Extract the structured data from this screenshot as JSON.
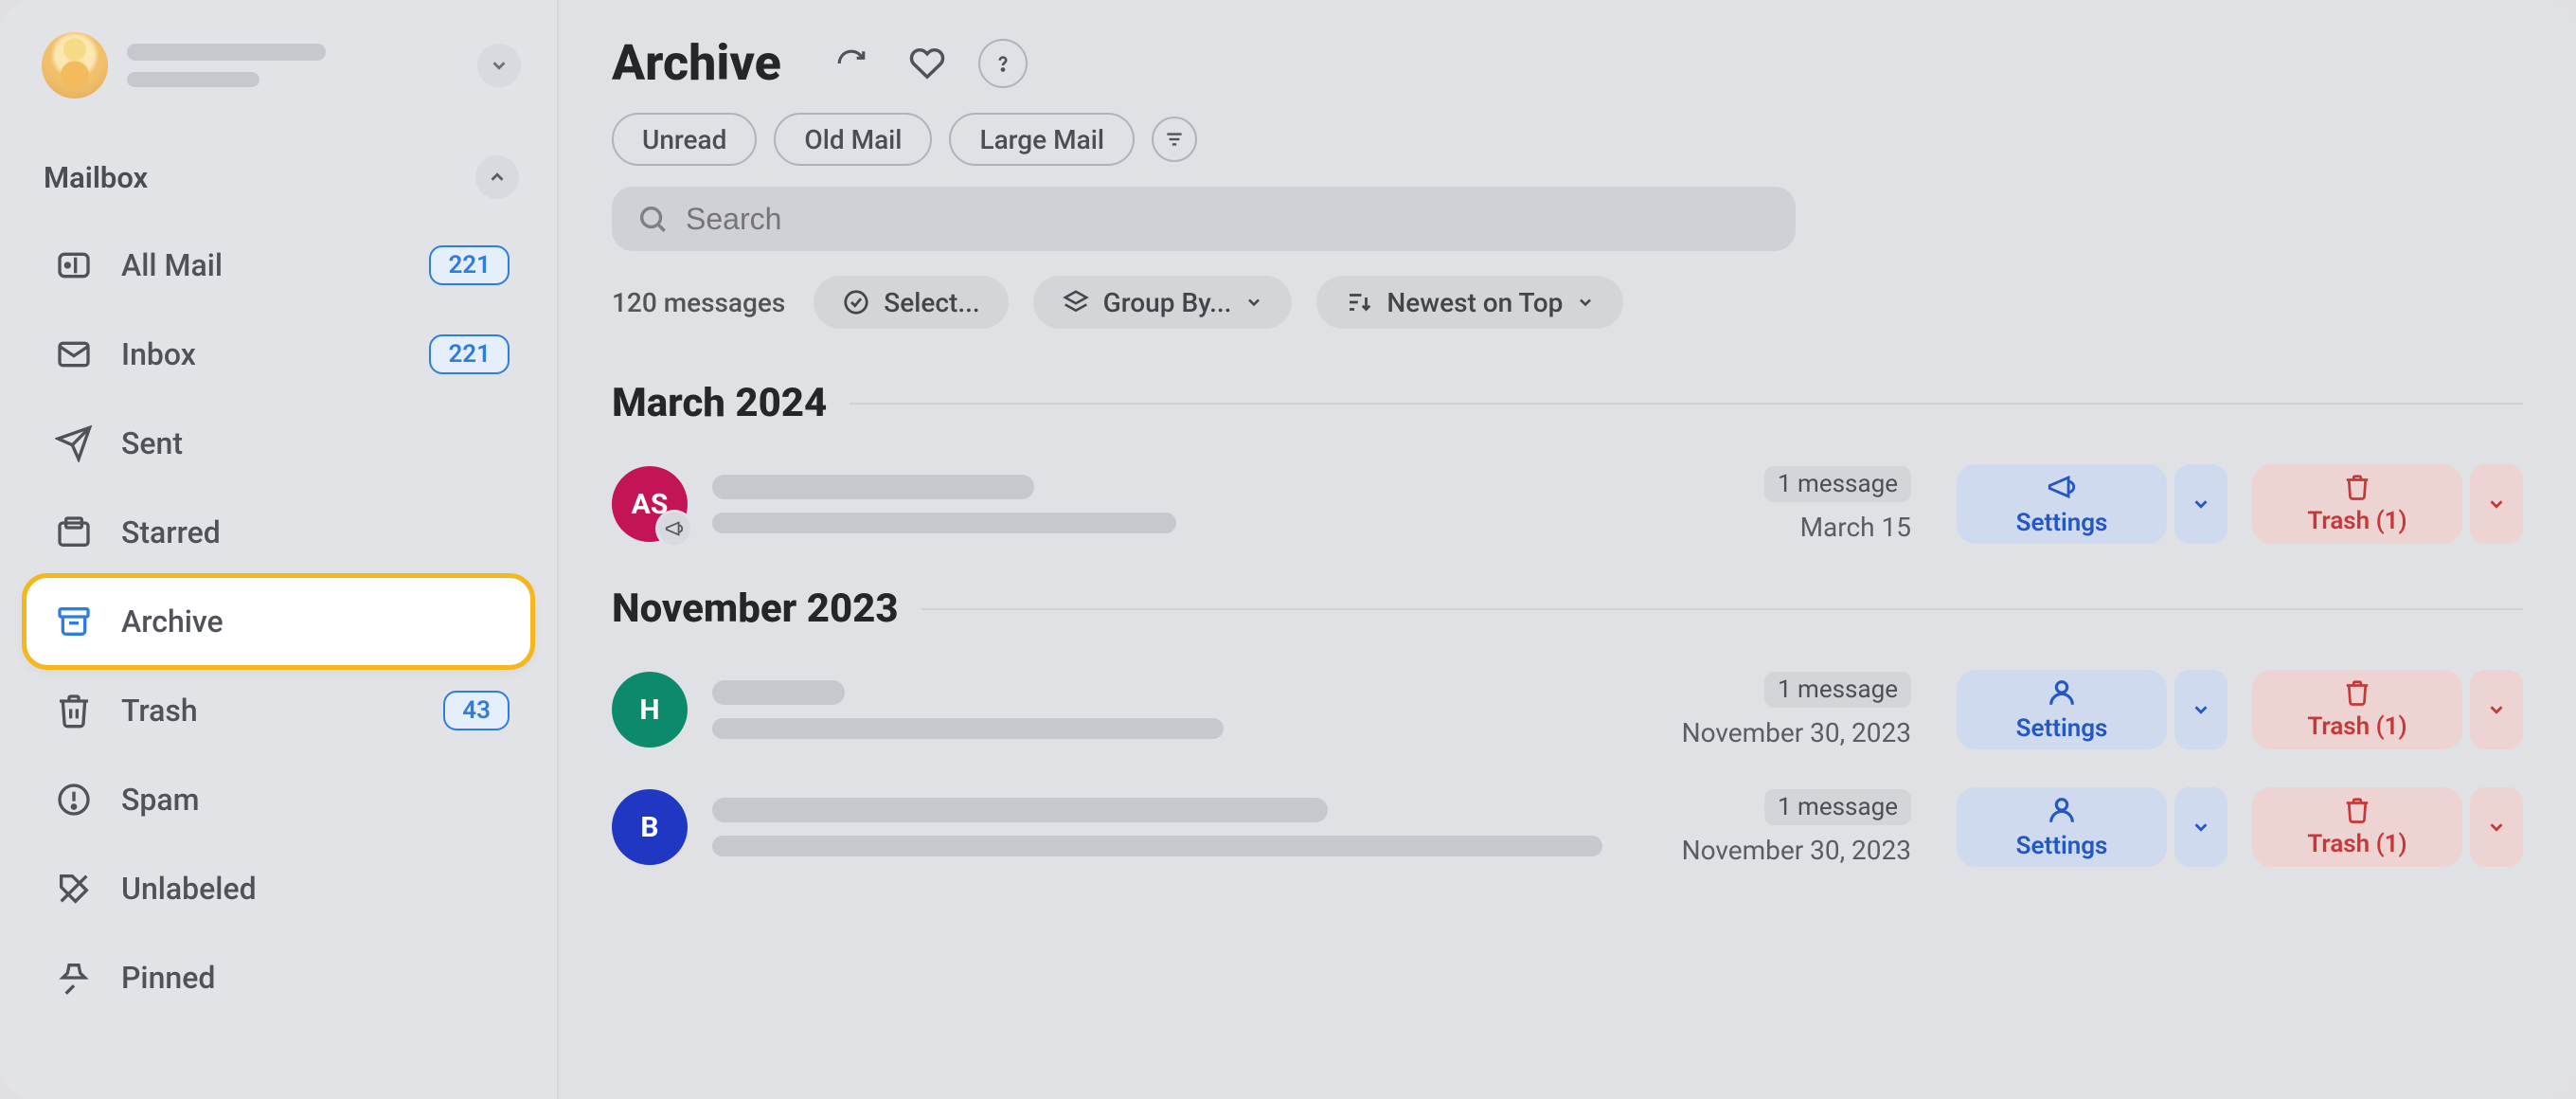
{
  "sidebar": {
    "section_title": "Mailbox",
    "items": [
      {
        "label": "All Mail",
        "badge": "221"
      },
      {
        "label": "Inbox",
        "badge": "221"
      },
      {
        "label": "Sent",
        "badge": null
      },
      {
        "label": "Starred",
        "badge": null
      },
      {
        "label": "Archive",
        "badge": null
      },
      {
        "label": "Trash",
        "badge": "43"
      },
      {
        "label": "Spam",
        "badge": null
      },
      {
        "label": "Unlabeled",
        "badge": null
      },
      {
        "label": "Pinned",
        "badge": null
      }
    ]
  },
  "main": {
    "title": "Archive",
    "chips": [
      "Unread",
      "Old Mail",
      "Large Mail"
    ],
    "search_placeholder": "Search",
    "message_count": "120 messages",
    "select_label": "Select...",
    "groupby_label": "Group By...",
    "sort_label": "Newest on Top",
    "groups": [
      {
        "heading": "March 2024",
        "messages": [
          {
            "avatar_text": "AS",
            "avatar_color": "#c31456",
            "has_marketing_badge": true,
            "count_label": "1 message",
            "date": "March 15",
            "settings_label": "Settings",
            "trash_label": "Trash (1)",
            "line1_w": 340,
            "line2_w": 490,
            "settings_icon": "megaphone"
          }
        ]
      },
      {
        "heading": "November 2023",
        "messages": [
          {
            "avatar_text": "H",
            "avatar_color": "#0c8a6b",
            "has_marketing_badge": false,
            "count_label": "1 message",
            "date": "November 30, 2023",
            "settings_label": "Settings",
            "trash_label": "Trash (1)",
            "line1_w": 140,
            "line2_w": 540,
            "settings_icon": "person"
          },
          {
            "avatar_text": "B",
            "avatar_color": "#2037c3",
            "has_marketing_badge": false,
            "count_label": "1 message",
            "date": "November 30, 2023",
            "settings_label": "Settings",
            "trash_label": "Trash (1)",
            "line1_w": 650,
            "line2_w": 940,
            "settings_icon": "person"
          }
        ]
      }
    ]
  }
}
